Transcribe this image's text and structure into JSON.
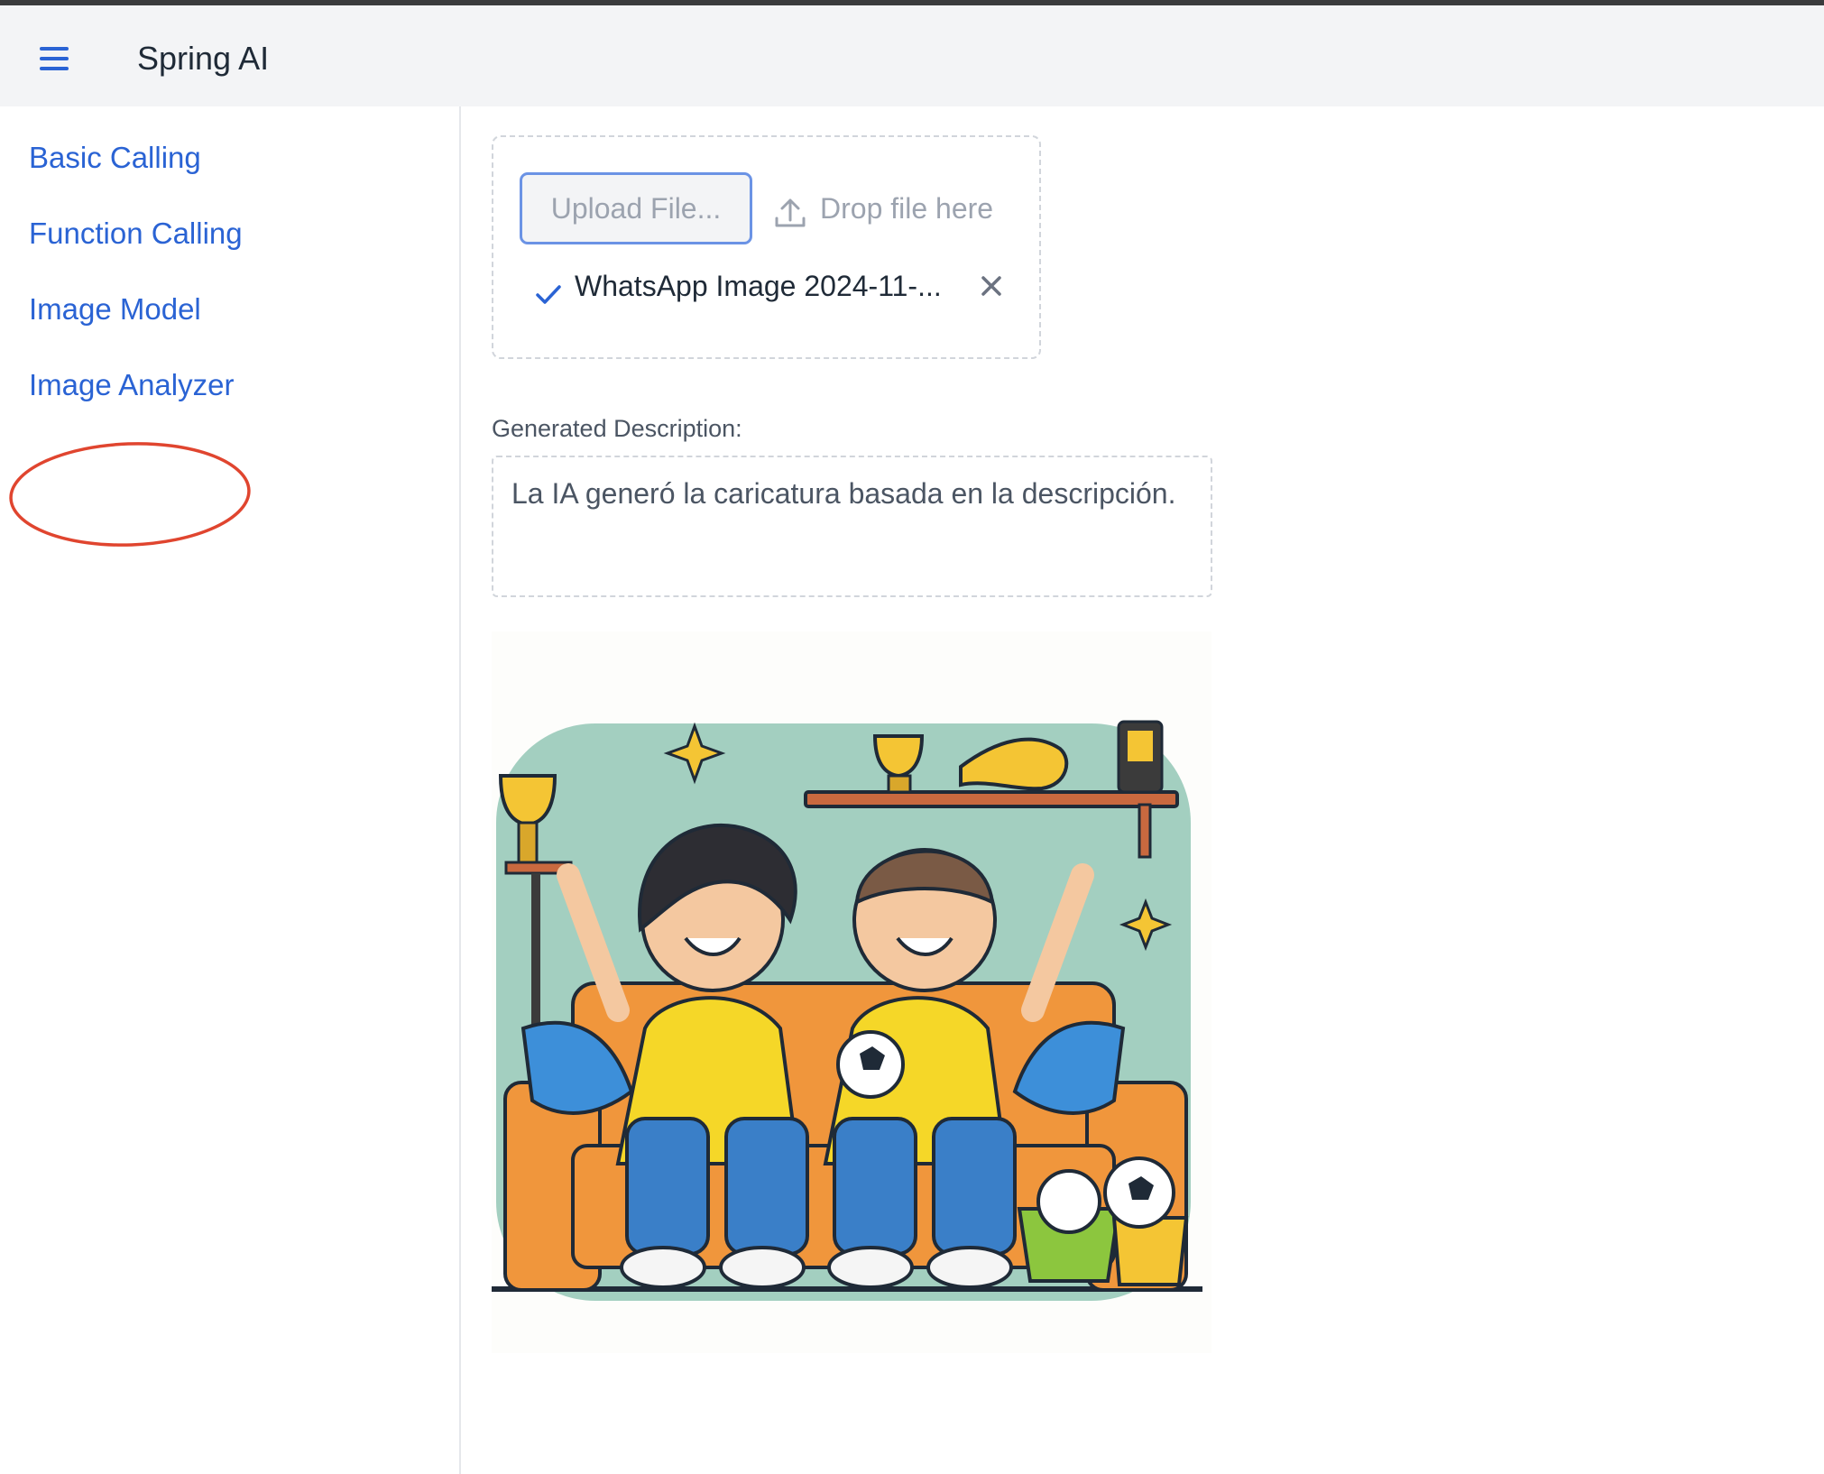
{
  "app": {
    "title": "Spring AI",
    "menu_icon": "hamburger-menu-icon"
  },
  "sidebar": {
    "items": [
      {
        "label": "Basic Calling"
      },
      {
        "label": "Function Calling"
      },
      {
        "label": "Image Model"
      },
      {
        "label": "Image Analyzer"
      }
    ]
  },
  "upload": {
    "button_label": "Upload File...",
    "drop_label": "Drop file here",
    "drop_icon": "upload-arrow-icon",
    "file": {
      "name": "WhatsApp Image 2024-11-...",
      "status_icon": "checkmark-icon",
      "remove_icon": "close-icon"
    }
  },
  "description": {
    "label": "Generated Description:",
    "text": "La IA generó la caricatura basada en la descripción."
  },
  "colors": {
    "accent": "#2a63d4",
    "highlight_circle": "#e0452f",
    "header_bg": "#f3f4f6"
  }
}
